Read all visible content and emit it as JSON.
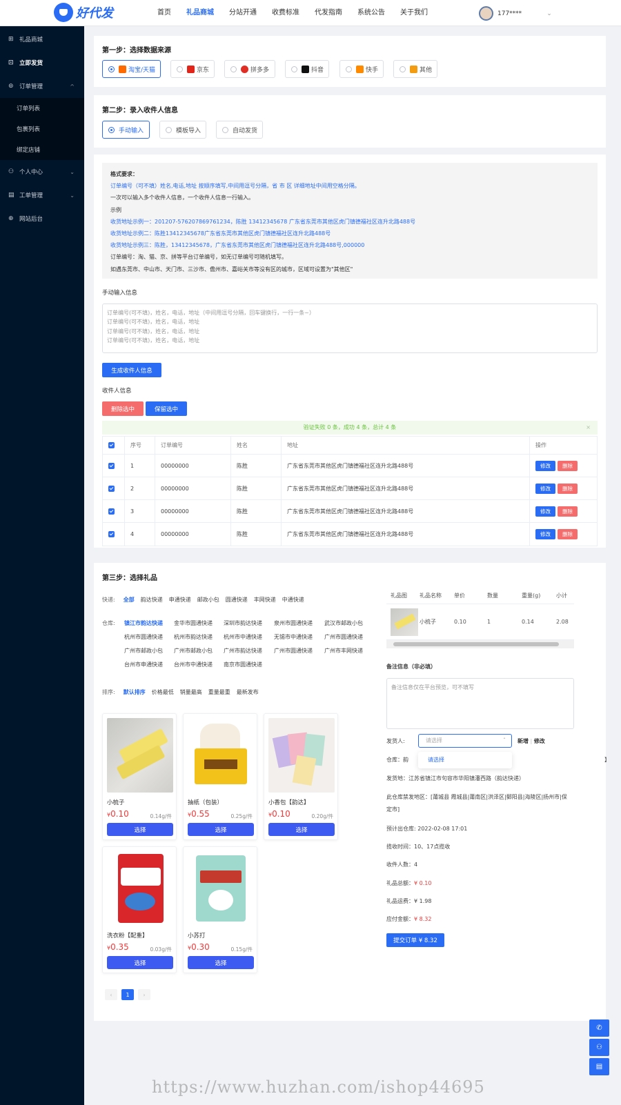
{
  "header": {
    "logo_text": "好代发",
    "nav": [
      "首页",
      "礼品商城",
      "分站开通",
      "收费标准",
      "代发指南",
      "系统公告",
      "关于我们"
    ],
    "active_nav": 1,
    "user_name": "177****",
    "user_caret": "⌄"
  },
  "sidebar": {
    "items": [
      {
        "icon": "⊞",
        "label": "礼品商城"
      },
      {
        "icon": "⊡",
        "label": "立即发货"
      },
      {
        "icon": "⊚",
        "label": "订单管理",
        "arrow": "^"
      },
      {
        "label": "订单列表"
      },
      {
        "label": "包裹列表"
      },
      {
        "label": "绑定店铺"
      },
      {
        "icon": "⚇",
        "label": "个人中心",
        "arrow": "⌄"
      },
      {
        "icon": "▤",
        "label": "工单管理",
        "arrow": "⌄"
      },
      {
        "icon": "⊕",
        "label": "网站后台"
      }
    ]
  },
  "step1": {
    "title": "第一步：选择数据来源",
    "options": [
      {
        "label": "淘宝/天猫",
        "color": "#ff6a00"
      },
      {
        "label": "京东",
        "color": "#e1251b"
      },
      {
        "label": "拼多多",
        "color": "#e02e24"
      },
      {
        "label": "抖音",
        "color": "#111111"
      },
      {
        "label": "快手",
        "color": "#ff8a00"
      },
      {
        "label": "其他",
        "color": "#f39c12"
      }
    ]
  },
  "step2": {
    "title": "第二步：录入收件人信息",
    "options": [
      "手动输入",
      "模板导入",
      "自动发货"
    ]
  },
  "help": {
    "lines": [
      "格式要求：",
      "订单编号（可不填）姓名,电话,地址 按顺序填写,中间用逗号分隔，省 市 区 详细地址中间用空格分隔。",
      "一次可以输入多个收件人信息，一个收件人信息一行输入。",
      "示例",
      "收货地址示例一：201207-576207869761234，陈胜 13412345678 广东省东莞市其他区虎门镇德福社区连升北路488号",
      "收货地址示例二：陈胜13412345678广东省东莞市其他区虎门镇德福社区连升北路488号",
      "收货地址示例三：陈胜，13412345678，广东省东莞市其他区虎门镇德福社区连升北路488号,000000",
      "订单编号：淘、猫、京、拼等平台订单编号，如无订单编号可随机填写。",
      "如遇东莞市、中山市、天门市、三沙市、儋州市、嘉峪关市等没有区的城市，区域可设置为\"其他区\""
    ]
  },
  "manual": {
    "label": "手动输入信息",
    "placeholder": "订单编号(可不填)，姓名，电话，地址（中间用逗号分隔，回车键换行，一行一条~）\n订单编号(可不填)，姓名，电话，地址\n订单编号(可不填)，姓名，电话，地址\n订单编号(可不填)，姓名，电话，地址",
    "generate_btn": "生成收件人信息",
    "recipients_label": "收件人信息",
    "delete_btn": "删除选中",
    "keep_btn": "保留选中",
    "alert": "验证失败 0 条，成功 4 条，总计 4 条",
    "alert_close": "×"
  },
  "recipients_table": {
    "headers": [
      "序号",
      "订单编号",
      "姓名",
      "地址",
      "操作"
    ],
    "rows": [
      {
        "no": "1",
        "order": "00000000",
        "name": "陈胜",
        "address": "广东省东莞市其他区虎门镇德福社区连升北路488号"
      },
      {
        "no": "2",
        "order": "00000000",
        "name": "陈胜",
        "address": "广东省东莞市其他区虎门镇德福社区连升北路488号"
      },
      {
        "no": "3",
        "order": "00000000",
        "name": "陈胜",
        "address": "广东省东莞市其他区虎门镇德福社区连升北路488号"
      },
      {
        "no": "4",
        "order": "00000000",
        "name": "陈胜",
        "address": "广东省东莞市其他区虎门镇德福社区连升北路488号"
      }
    ],
    "edit_label": "修改",
    "delete_label": "删除"
  },
  "step3": {
    "title": "第三步：选择礼品",
    "express_label": "快递:",
    "express_options": [
      "全部",
      "韵达快递",
      "申通快递",
      "邮政小包",
      "圆通快递",
      "丰网快递",
      "中通快递"
    ],
    "warehouse_label": "仓库:",
    "warehouses": [
      "镇江市韵达快递",
      "金华市圆通快递",
      "深圳市韵达快递",
      "泉州市圆通快递",
      "武汉市邮政小包",
      "杭州市圆通快递",
      "杭州市韵达快递",
      "杭州市中通快递",
      "无锡市中通快递",
      "广州市圆通快递",
      "广州市邮政小包",
      "广州市邮政小包",
      "广州市韵达快递",
      "广州市圆通快递",
      "广州市丰网快递",
      "台州市申通快递",
      "台州市中通快递",
      "南京市圆通快递"
    ],
    "sort_label": "排序:",
    "sort_options": [
      "默认排序",
      "价格最低",
      "销量最高",
      "重量最重",
      "最新发布"
    ],
    "select_label": "选择",
    "products": [
      {
        "name": "小梳子",
        "price": "0.10",
        "weight": "0.14g/件"
      },
      {
        "name": "抽纸（包装）",
        "price": "0.55",
        "weight": "0.25g/件"
      },
      {
        "name": "小香包【韵达】",
        "price": "0.10",
        "weight": "0.20g/件"
      },
      {
        "name": "洗衣粉【配重】",
        "price": "0.35",
        "weight": "0.03g/件"
      },
      {
        "name": "小苏打",
        "price": "0.30",
        "weight": "0.15g/件"
      }
    ],
    "pager": {
      "prev": "‹",
      "current": "1",
      "next": "›"
    }
  },
  "order": {
    "headers": [
      "礼品图",
      "礼品名称",
      "单价",
      "数量",
      "重量(g)",
      "小计"
    ],
    "row": {
      "name": "小梳子",
      "price": "0.10",
      "qty": "1",
      "weight": "0.14",
      "subtotal": "2.08"
    },
    "remark_label": "备注信息（非必填）",
    "remark_placeholder": "备注信息仅在平台预览，可不填写",
    "sender_label": "发货人:",
    "sender_placeholder": "请选择",
    "dropdown_option": "请选择",
    "new_label": "新增",
    "sep": "|",
    "modify_label": "修改",
    "warehouse_line": "仓库：韵",
    "warehouse_tail": "】",
    "origin_line": "发货地：江苏省镇江市句容市华阳镇潘西路（韵达快递）",
    "restricted_line1": "此仓库禁发地区：[莆城县 霞城县|莆南区|洪泽区|鄄阳县|海陵区|扬州市|保",
    "restricted_line2": "定市]",
    "eta_line": "预计出仓库: 2022-02-08 17:01",
    "cutoff_line": "揽收时间：10、17点揽收",
    "count_label": "收件人数：",
    "count_value": "4",
    "gift_total_label": "礼品总额：",
    "gift_total_value": "¥ 0.10",
    "shipping_label": "礼品运费：",
    "shipping_value": "¥ 1.98",
    "payable_label": "应付金额：",
    "payable_value": "¥ 8.32",
    "submit_btn": "提交订单 ¥ 8.32"
  },
  "float_tools": [
    "✆",
    "⚇",
    "▤"
  ],
  "watermark": "https://www.huzhan.com/ishop44695"
}
